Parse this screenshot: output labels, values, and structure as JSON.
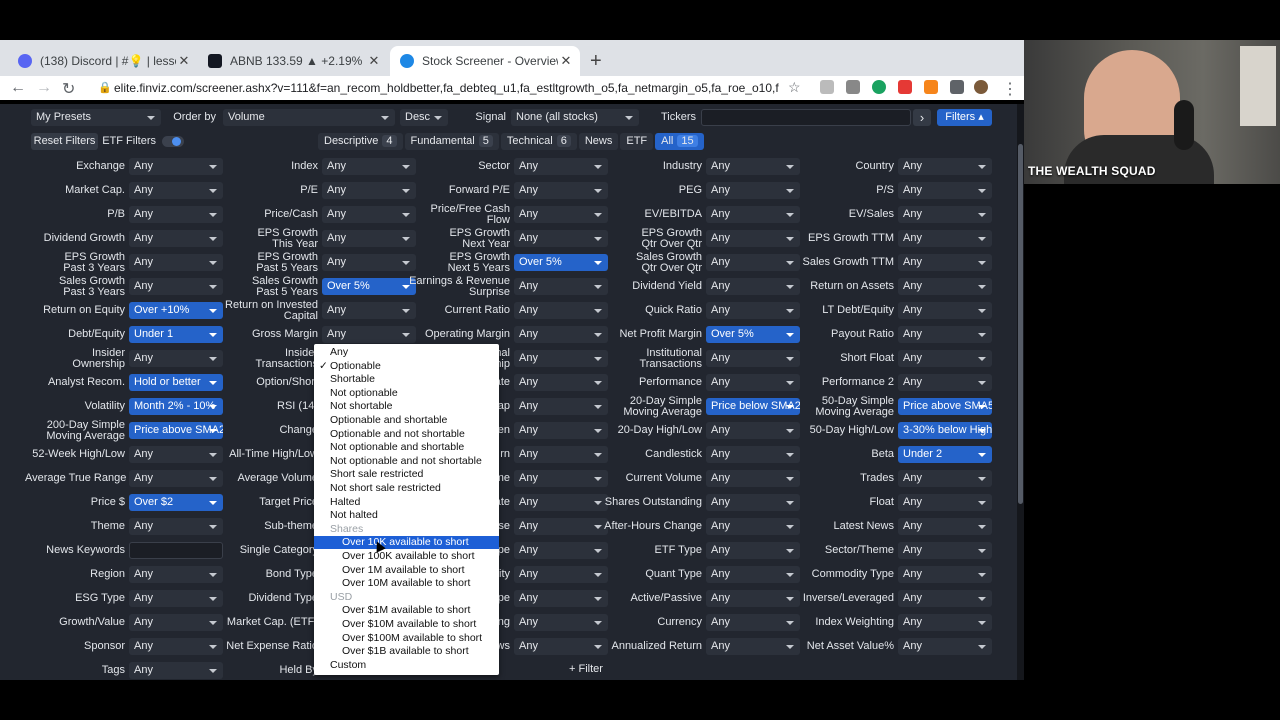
{
  "browser": {
    "tabs": [
      {
        "title": "(138) Discord | #💡 | lesson-s",
        "close": "✕",
        "favicon_color": "#5865f2"
      },
      {
        "title": "ABNB 133.59 ▲ +2.19% Unna",
        "close": "✕",
        "favicon_color": "#131722"
      },
      {
        "title": "Stock Screener - Overview ho",
        "close": "✕",
        "favicon_color": "#1e88e5"
      }
    ],
    "new_tab": "+",
    "back": "←",
    "forward": "→",
    "reload": "↻",
    "url": "elite.finviz.com/screener.ashx?v=111&f=an_recom_holdbetter,fa_debteq_u1,fa_estltgrowth_o5,fa_netmargin_o5,fa_roe_o10,f...",
    "lock": "🔒",
    "star": "☆",
    "menu": "⋮"
  },
  "toolbar": {
    "presets": "My Presets",
    "order_by_label": "Order by",
    "order_by_value": "Volume",
    "direction": "Desc",
    "signal_label": "Signal",
    "signal_value": "None (all stocks)",
    "tickers_label": "Tickers",
    "tickers_value": "",
    "go": "›",
    "filters": "Filters"
  },
  "filter_tabs": {
    "reset": "Reset Filters",
    "etf_filters": "ETF Filters",
    "tabs": [
      {
        "label": "Descriptive",
        "count": "4"
      },
      {
        "label": "Fundamental",
        "count": "5"
      },
      {
        "label": "Technical",
        "count": "6"
      },
      {
        "label": "News",
        "count": ""
      },
      {
        "label": "ETF",
        "count": ""
      },
      {
        "label": "All",
        "count": "15"
      }
    ]
  },
  "filters": {
    "col1": [
      {
        "label": "Exchange",
        "value": "Any"
      },
      {
        "label": "Market Cap.",
        "value": "Any"
      },
      {
        "label": "P/B",
        "value": "Any"
      },
      {
        "label": "Dividend Growth",
        "value": "Any"
      },
      {
        "label": "EPS Growth\nPast 3 Years",
        "value": "Any"
      },
      {
        "label": "Sales Growth\nPast 3 Years",
        "value": "Any"
      },
      {
        "label": "Return on Equity",
        "value": "Over +10%",
        "on": true
      },
      {
        "label": "Debt/Equity",
        "value": "Under 1",
        "on": true
      },
      {
        "label": "Insider\nOwnership",
        "value": "Any"
      },
      {
        "label": "Analyst Recom.",
        "value": "Hold or better",
        "on": true
      },
      {
        "label": "Volatility",
        "value": "Month 2% - 10%",
        "on": true
      },
      {
        "label": "200-Day Simple\nMoving Average",
        "value": "Price above SMA200",
        "on": true
      },
      {
        "label": "52-Week High/Low",
        "value": "Any"
      },
      {
        "label": "Average True Range",
        "value": "Any"
      },
      {
        "label": "Price $",
        "value": "Over $2",
        "on": true
      },
      {
        "label": "Theme",
        "value": "Any"
      },
      {
        "label": "News Keywords",
        "value": "",
        "input": true
      },
      {
        "label": "Region",
        "value": "Any"
      },
      {
        "label": "ESG Type",
        "value": "Any"
      },
      {
        "label": "Growth/Value",
        "value": "Any"
      },
      {
        "label": "Sponsor",
        "value": "Any"
      },
      {
        "label": "Tags",
        "value": "Any"
      }
    ],
    "col2": [
      {
        "label": "Index",
        "value": "Any"
      },
      {
        "label": "P/E",
        "value": "Any"
      },
      {
        "label": "Price/Cash",
        "value": "Any"
      },
      {
        "label": "EPS Growth\nThis Year",
        "value": "Any"
      },
      {
        "label": "EPS Growth\nPast 5 Years",
        "value": "Any"
      },
      {
        "label": "Sales Growth\nPast 5 Years",
        "value": "Over 5%",
        "on": true
      },
      {
        "label": "Return on Invested\nCapital",
        "value": "Any"
      },
      {
        "label": "Gross Margin",
        "value": "Any"
      },
      {
        "label": "Insider\nTransactions",
        "value": ""
      },
      {
        "label": "Option/Short",
        "value": ""
      },
      {
        "label": "RSI (14)",
        "value": ""
      },
      {
        "label": "Change",
        "value": ""
      },
      {
        "label": "All-Time High/Low",
        "value": ""
      },
      {
        "label": "Average Volume",
        "value": ""
      },
      {
        "label": "Target Price",
        "value": ""
      },
      {
        "label": "Sub-theme",
        "value": ""
      },
      {
        "label": "Single Category",
        "value": ""
      },
      {
        "label": "Bond Type",
        "value": ""
      },
      {
        "label": "Dividend Type",
        "value": ""
      },
      {
        "label": "Market Cap. (ETF)",
        "value": ""
      },
      {
        "label": "Net Expense Ratio",
        "value": ""
      },
      {
        "label": "Held By",
        "value": ""
      }
    ],
    "col3": [
      {
        "label": "Sector",
        "value": "Any"
      },
      {
        "label": "Forward P/E",
        "value": "Any"
      },
      {
        "label": "Price/Free Cash\nFlow",
        "value": "Any"
      },
      {
        "label": "EPS Growth\nNext Year",
        "value": "Any"
      },
      {
        "label": "EPS Growth\nNext 5 Years",
        "value": "Over 5%",
        "on": true
      },
      {
        "label": "Earnings & Revenue\nSurprise",
        "value": "Any"
      },
      {
        "label": "Current Ratio",
        "value": "Any"
      },
      {
        "label": "Operating Margin",
        "value": "Any"
      },
      {
        "label": "nal\nnip",
        "value": "Any"
      },
      {
        "label": "ate",
        "value": "Any"
      },
      {
        "label": "ap",
        "value": "Any"
      },
      {
        "label": "en",
        "value": "Any"
      },
      {
        "label": "rn",
        "value": "Any"
      },
      {
        "label": "me",
        "value": "Any"
      },
      {
        "label": "ate",
        "value": "Any"
      },
      {
        "label": "se",
        "value": "Any"
      },
      {
        "label": "pe",
        "value": "Any"
      },
      {
        "label": "ity",
        "value": "Any"
      },
      {
        "label": "pe",
        "value": "Any"
      },
      {
        "label": "ing",
        "value": "Any"
      },
      {
        "label": "ws",
        "value": "Any"
      }
    ],
    "col4": [
      {
        "label": "Industry",
        "value": "Any"
      },
      {
        "label": "PEG",
        "value": "Any"
      },
      {
        "label": "EV/EBITDA",
        "value": "Any"
      },
      {
        "label": "EPS Growth\nQtr Over Qtr",
        "value": "Any"
      },
      {
        "label": "Sales Growth\nQtr Over Qtr",
        "value": "Any"
      },
      {
        "label": "Dividend Yield",
        "value": "Any"
      },
      {
        "label": "Quick Ratio",
        "value": "Any"
      },
      {
        "label": "Net Profit Margin",
        "value": "Over 5%",
        "on": true
      },
      {
        "label": "Institutional\nTransactions",
        "value": "Any"
      },
      {
        "label": "Performance",
        "value": "Any"
      },
      {
        "label": "20-Day Simple\nMoving Average",
        "value": "Price below SMA20",
        "on": true
      },
      {
        "label": "20-Day High/Low",
        "value": "Any"
      },
      {
        "label": "Candlestick",
        "value": "Any"
      },
      {
        "label": "Current Volume",
        "value": "Any"
      },
      {
        "label": "Shares Outstanding",
        "value": "Any"
      },
      {
        "label": "After-Hours Change",
        "value": "Any"
      },
      {
        "label": "ETF Type",
        "value": "Any"
      },
      {
        "label": "Quant Type",
        "value": "Any"
      },
      {
        "label": "Active/Passive",
        "value": "Any"
      },
      {
        "label": "Currency",
        "value": "Any"
      },
      {
        "label": "Annualized Return",
        "value": "Any"
      }
    ],
    "col5": [
      {
        "label": "Country",
        "value": "Any"
      },
      {
        "label": "P/S",
        "value": "Any"
      },
      {
        "label": "EV/Sales",
        "value": "Any"
      },
      {
        "label": "EPS Growth TTM",
        "value": "Any"
      },
      {
        "label": "Sales Growth TTM",
        "value": "Any"
      },
      {
        "label": "Return on Assets",
        "value": "Any"
      },
      {
        "label": "LT Debt/Equity",
        "value": "Any"
      },
      {
        "label": "Payout Ratio",
        "value": "Any"
      },
      {
        "label": "Short Float",
        "value": "Any"
      },
      {
        "label": "Performance 2",
        "value": "Any"
      },
      {
        "label": "50-Day Simple\nMoving Average",
        "value": "Price above SMA50",
        "on": true
      },
      {
        "label": "50-Day High/Low",
        "value": "3-30% below High",
        "on": true
      },
      {
        "label": "Beta",
        "value": "Under 2",
        "on": true
      },
      {
        "label": "Trades",
        "value": "Any"
      },
      {
        "label": "Float",
        "value": "Any"
      },
      {
        "label": "Latest News",
        "value": "Any"
      },
      {
        "label": "Sector/Theme",
        "value": "Any"
      },
      {
        "label": "Commodity Type",
        "value": "Any"
      },
      {
        "label": "Inverse/Leveraged",
        "value": "Any"
      },
      {
        "label": "Index Weighting",
        "value": "Any"
      },
      {
        "label": "Net Asset Value%",
        "value": "Any"
      }
    ],
    "add_filter": "+ Filter"
  },
  "dropdown": {
    "check": "✓",
    "items": [
      {
        "text": "Any",
        "indent": 0
      },
      {
        "text": "Optionable",
        "indent": 0,
        "checked": true
      },
      {
        "text": "Shortable",
        "indent": 0
      },
      {
        "text": "Not optionable",
        "indent": 0
      },
      {
        "text": "Not shortable",
        "indent": 0
      },
      {
        "text": "Optionable and shortable",
        "indent": 0
      },
      {
        "text": "Optionable and not shortable",
        "indent": 0
      },
      {
        "text": "Not optionable and shortable",
        "indent": 0
      },
      {
        "text": "Not optionable and not shortable",
        "indent": 0
      },
      {
        "text": "Short sale restricted",
        "indent": 0
      },
      {
        "text": "Not short sale restricted",
        "indent": 0
      },
      {
        "text": "Halted",
        "indent": 0
      },
      {
        "text": "Not halted",
        "indent": 0
      },
      {
        "text": "Shares",
        "group": true
      },
      {
        "text": "Over 10K available to short",
        "indent": 1,
        "highlight": true
      },
      {
        "text": "Over 100K available to short",
        "indent": 1
      },
      {
        "text": "Over 1M available to short",
        "indent": 1
      },
      {
        "text": "Over 10M available to short",
        "indent": 1
      },
      {
        "text": "USD",
        "group": true
      },
      {
        "text": "Over $1M available to short",
        "indent": 1
      },
      {
        "text": "Over $10M available to short",
        "indent": 1
      },
      {
        "text": "Over $100M available to short",
        "indent": 1
      },
      {
        "text": "Over $1B available to short",
        "indent": 1
      },
      {
        "text": "Custom",
        "indent": 0
      }
    ]
  },
  "webcam": {
    "caption": "THE WEALTH SQUAD"
  },
  "colors": {
    "accent": "#2563c9",
    "panel": "#22262f",
    "control": "#2c313b",
    "highlight": "#1d5fd6"
  }
}
